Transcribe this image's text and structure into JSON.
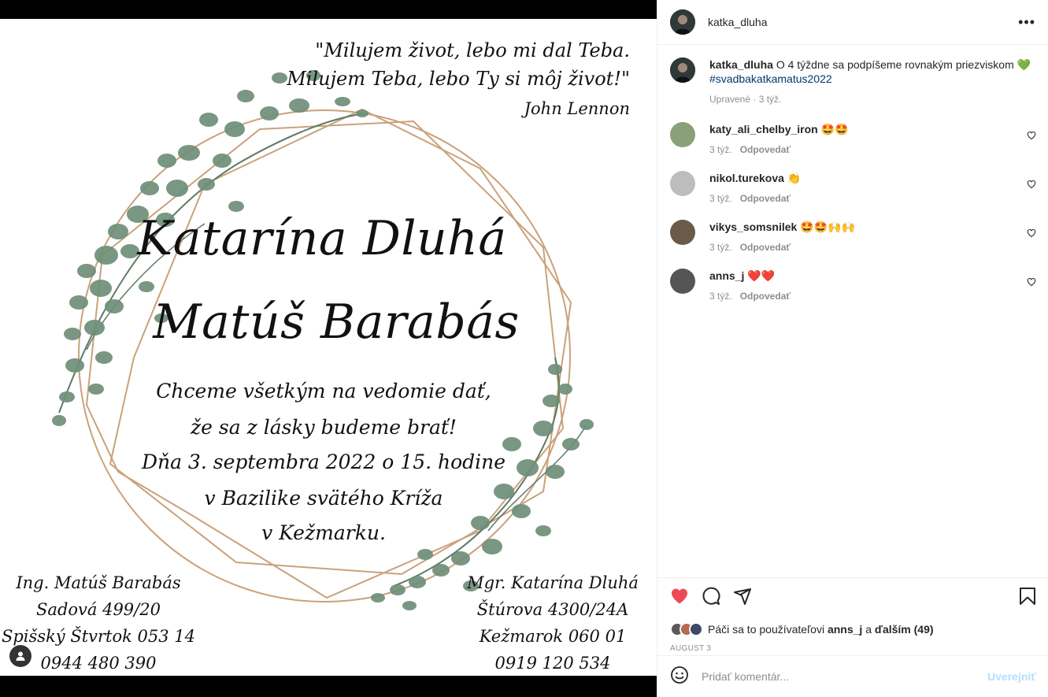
{
  "post": {
    "username": "katka_dluha",
    "more_icon": "more-horizontal-icon"
  },
  "invitation": {
    "quote_lines": [
      "\"Milujem život, lebo mi dal Teba.",
      "Milujem Teba, lebo Ty si môj život!\"",
      "John Lennon"
    ],
    "name_bride": "Katarína Dluhá",
    "name_groom": "Matúš Barabás",
    "message_lines": [
      "Chceme všetkým na vedomie dať,",
      "že sa z lásky budeme brať!",
      "Dňa 3. septembra 2022 o 15. hodine",
      "v Bazilike svätého Kríža",
      "v Kežmarku."
    ],
    "address_left": [
      "Ing. Matúš Barabás",
      "Sadová 499/20",
      "Spišský Štvrtok 053 14",
      "0944 480 390"
    ],
    "address_right": [
      "Mgr. Katarína Dluhá",
      "Štúrova 4300/24A",
      "Kežmarok 060 01",
      "0919 120 534"
    ],
    "colors": {
      "leaf": "#6e8f78",
      "leaf_dark": "#4f6f5a",
      "gold": "#c9a27a"
    }
  },
  "caption": {
    "username": "katka_dluha",
    "text": "O 4 týždne sa podpíšeme rovnakým priezviskom 💚",
    "hashtag": "#svadbakatkamatus2022",
    "meta": "Upravené · 3 týž."
  },
  "comments": [
    {
      "username": "katy_ali_chelby_iron",
      "text": "🤩🤩",
      "time": "3 týž.",
      "reply": "Odpovedať",
      "avatar_color": "#8aa07a"
    },
    {
      "username": "nikol.turekova",
      "text": "👏",
      "time": "3 týž.",
      "reply": "Odpovedať",
      "avatar_color": "#bdbdbd"
    },
    {
      "username": "vikys_somsnilek",
      "text": "🤩🤩🙌🙌",
      "time": "3 týž.",
      "reply": "Odpovedať",
      "avatar_color": "#6b5a4a"
    },
    {
      "username": "anns_j",
      "text": "❤️❤️",
      "time": "3 týž.",
      "reply": "Odpovedať",
      "avatar_color": "#555555"
    }
  ],
  "likes": {
    "prefix": "Páči sa to používateľovi",
    "user": "anns_j",
    "conj": "a",
    "others": "ďalším (49)"
  },
  "date": "AUGUST 3",
  "add_comment": {
    "placeholder": "Pridať komentár...",
    "post_label": "Uverejniť"
  },
  "colors": {
    "like_red": "#ed4956",
    "link_blue": "#00376b",
    "post_disabled": "#b2dffc"
  }
}
